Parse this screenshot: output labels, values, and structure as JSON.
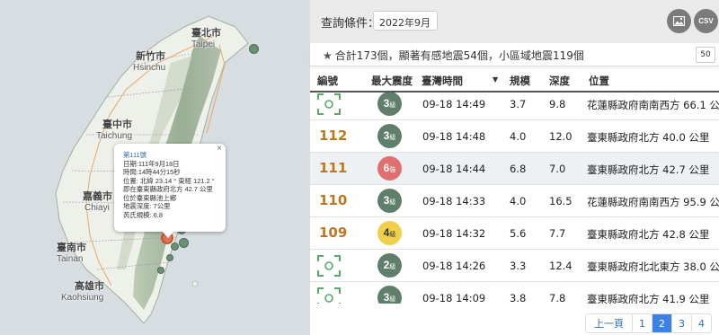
{
  "map": {
    "cities": [
      {
        "id": "taipei-zh",
        "text": "臺北市"
      },
      {
        "id": "taipei-en",
        "text": "Taipei"
      },
      {
        "id": "hsinchu-zh",
        "text": "新竹市"
      },
      {
        "id": "hsinchu-en",
        "text": "Hsinchu"
      },
      {
        "id": "taichung-zh",
        "text": "臺中市"
      },
      {
        "id": "taichung-en",
        "text": "Taichung"
      },
      {
        "id": "chiayi-zh",
        "text": "嘉義市"
      },
      {
        "id": "chiayi-en",
        "text": "Chiayi"
      },
      {
        "id": "tainan-zh",
        "text": "臺南市"
      },
      {
        "id": "tainan-en",
        "text": "Tainan"
      },
      {
        "id": "kaohsiung-zh",
        "text": "高雄市"
      },
      {
        "id": "kaohsiung-en",
        "text": "Kaohsiung"
      }
    ],
    "popup": {
      "title": "第111號",
      "date": "日期:111年9月18日",
      "time": "時間:14時44分15秒",
      "position": "位置:  北緯 23.14 ° 東經 121.2 °",
      "relative": "即在臺東縣政府北方 42.7 公里",
      "county": "位於臺東縣池上鄉",
      "depth": "地震深度:  7公里",
      "magnitude": "芮氏規模:  6.8",
      "close": "×"
    }
  },
  "toolbar": {
    "query_label": "查詢條件：",
    "query_value": "2022年9月",
    "image_button": "image-icon",
    "csv_button": "CSV"
  },
  "summary": {
    "text": "合計173個，顯著有感地震54個，小區域地震119個",
    "per_page": "50"
  },
  "table": {
    "headers": {
      "id": "編號",
      "intensity": "最大震度",
      "time": "臺灣時間",
      "scale": "規模",
      "depth": "深度",
      "location": "位置"
    },
    "sort_indicator": "▼",
    "rows": [
      {
        "num": "",
        "intensity": "3",
        "unit": "級",
        "color": "g",
        "time": "09-18 14:49",
        "scale": "3.7",
        "depth": "9.8",
        "location": "花蓮縣政府南南西方 66.1 公里"
      },
      {
        "num": "112",
        "intensity": "3",
        "unit": "級",
        "color": "g",
        "time": "09-18 14:48",
        "scale": "4.0",
        "depth": "12.0",
        "location": "臺東縣政府北方 40.0 公里"
      },
      {
        "num": "111",
        "intensity": "6",
        "unit": "強",
        "color": "r",
        "time": "09-18 14:44",
        "scale": "6.8",
        "depth": "7.0",
        "location": "臺東縣政府北方 42.7 公里"
      },
      {
        "num": "110",
        "intensity": "3",
        "unit": "級",
        "color": "g",
        "time": "09-18 14:33",
        "scale": "4.0",
        "depth": "16.5",
        "location": "花蓮縣政府南南西方 95.9 公里"
      },
      {
        "num": "109",
        "intensity": "4",
        "unit": "級",
        "color": "y",
        "time": "09-18 14:32",
        "scale": "5.6",
        "depth": "7.7",
        "location": "臺東縣政府北方 42.8 公里"
      },
      {
        "num": "",
        "intensity": "2",
        "unit": "級",
        "color": "g",
        "time": "09-18 14:26",
        "scale": "3.3",
        "depth": "12.4",
        "location": "臺東縣政府北北東方 38.0 公里"
      },
      {
        "num": "",
        "intensity": "3",
        "unit": "級",
        "color": "g",
        "time": "09-18 14:09",
        "scale": "3.8",
        "depth": "7.8",
        "location": "臺東縣政府北方 41.9 公里"
      }
    ]
  },
  "pagination": {
    "prev": "上一頁",
    "pages": [
      "1",
      "2",
      "3",
      "4"
    ],
    "active": "2"
  },
  "colors": {
    "accent": "#3b82e6",
    "event_number": "#c0761a",
    "intensity_green": "#5f7e6c",
    "intensity_red": "#e07070",
    "intensity_yellow": "#f0d04a",
    "focus_icon": "#5aa86a"
  }
}
